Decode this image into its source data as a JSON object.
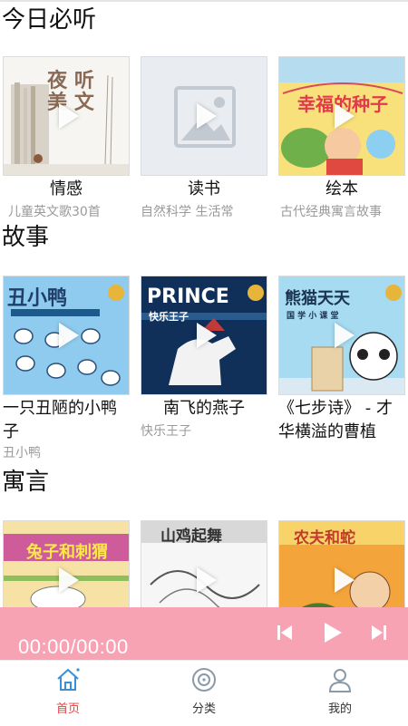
{
  "sections": [
    {
      "title": "今日必听",
      "items": [
        {
          "title": "情感",
          "subtitle": "儿童英文歌30首",
          "cover_text": [
            "夜",
            "听",
            "美",
            "文"
          ]
        },
        {
          "title": "读书",
          "subtitle": "自然科学 生活常",
          "cover_text": []
        },
        {
          "title": "绘本",
          "subtitle": "古代经典寓言故事",
          "cover_text": [
            "幸福的种子"
          ]
        }
      ]
    },
    {
      "title": "故事",
      "items": [
        {
          "title": "一只丑陋的小鸭子",
          "subtitle": "丑小鸭",
          "cover_text": [
            "丑小鸭"
          ]
        },
        {
          "title": "南飞的燕子",
          "subtitle": "快乐王子",
          "cover_text": [
            "PRINCE",
            "快乐王子"
          ]
        },
        {
          "title": "《七步诗》 - 才华横溢的曹植",
          "subtitle": "",
          "cover_text": [
            "熊猫天天",
            "国 学 小 课 堂"
          ]
        }
      ]
    },
    {
      "title": "寓言",
      "items": [
        {
          "title": "",
          "subtitle": "",
          "cover_text": [
            "兔子和刺猬"
          ]
        },
        {
          "title": "",
          "subtitle": "",
          "cover_text": [
            "山鸡起舞"
          ]
        },
        {
          "title": "",
          "subtitle": "",
          "cover_text": [
            "农夫和蛇"
          ]
        }
      ]
    }
  ],
  "player": {
    "time": "00:00/00:00",
    "icons": [
      "previous-icon",
      "play-icon",
      "next-icon"
    ]
  },
  "tabs": [
    {
      "label": "首页",
      "icon": "home-icon",
      "active": true
    },
    {
      "label": "分类",
      "icon": "disc-icon",
      "active": false
    },
    {
      "label": "我的",
      "icon": "user-icon",
      "active": false
    }
  ],
  "colors": {
    "player_bg": "#f7a3b4",
    "tab_active": "#e83e3e",
    "tab_icon_active": "#3a8fd8",
    "subtitle": "#9a9a9a"
  }
}
